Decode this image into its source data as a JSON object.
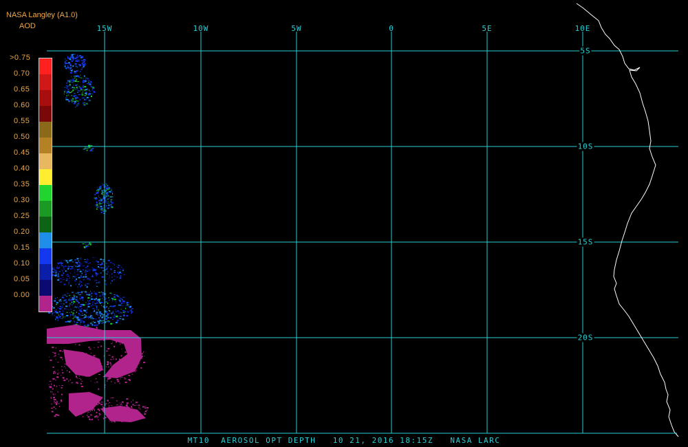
{
  "header": {
    "producer": "NASA Langley (A1.0)",
    "product": "AOD"
  },
  "map": {
    "longitude_labels": [
      "15W",
      "10W",
      "5W",
      "0",
      "5E",
      "10E"
    ],
    "latitude_labels": [
      "5S",
      "10S",
      "15S",
      "20S"
    ]
  },
  "legend": {
    "title": "AOD",
    "levels": [
      ">0.75",
      "0.70",
      "0.65",
      "0.60",
      "0.55",
      "0.50",
      "0.45",
      "0.40",
      "0.35",
      "0.30",
      "0.25",
      "0.20",
      "0.15",
      "0.10",
      "0.05",
      "0.00"
    ],
    "colors": [
      "#ff2020",
      "#d01818",
      "#a80e0e",
      "#7a0808",
      "#8a6a18",
      "#b48224",
      "#e8b860",
      "#ffee30",
      "#22d430",
      "#1a9a24",
      "#0c6414",
      "#1e8ee8",
      "#1438f0",
      "#0a1ea8",
      "#0a0a70",
      "#b0248c"
    ]
  },
  "colors": {
    "grid": "#27d0d8",
    "coast": "#ffffff",
    "label_orange": "#f0a848",
    "aod_low": "#b0248c",
    "aod_blue": "#1438f0"
  },
  "footer": {
    "caption": "MT10  AEROSOL OPT DEPTH   10 21, 2016 18:15Z   NASA LARC"
  }
}
